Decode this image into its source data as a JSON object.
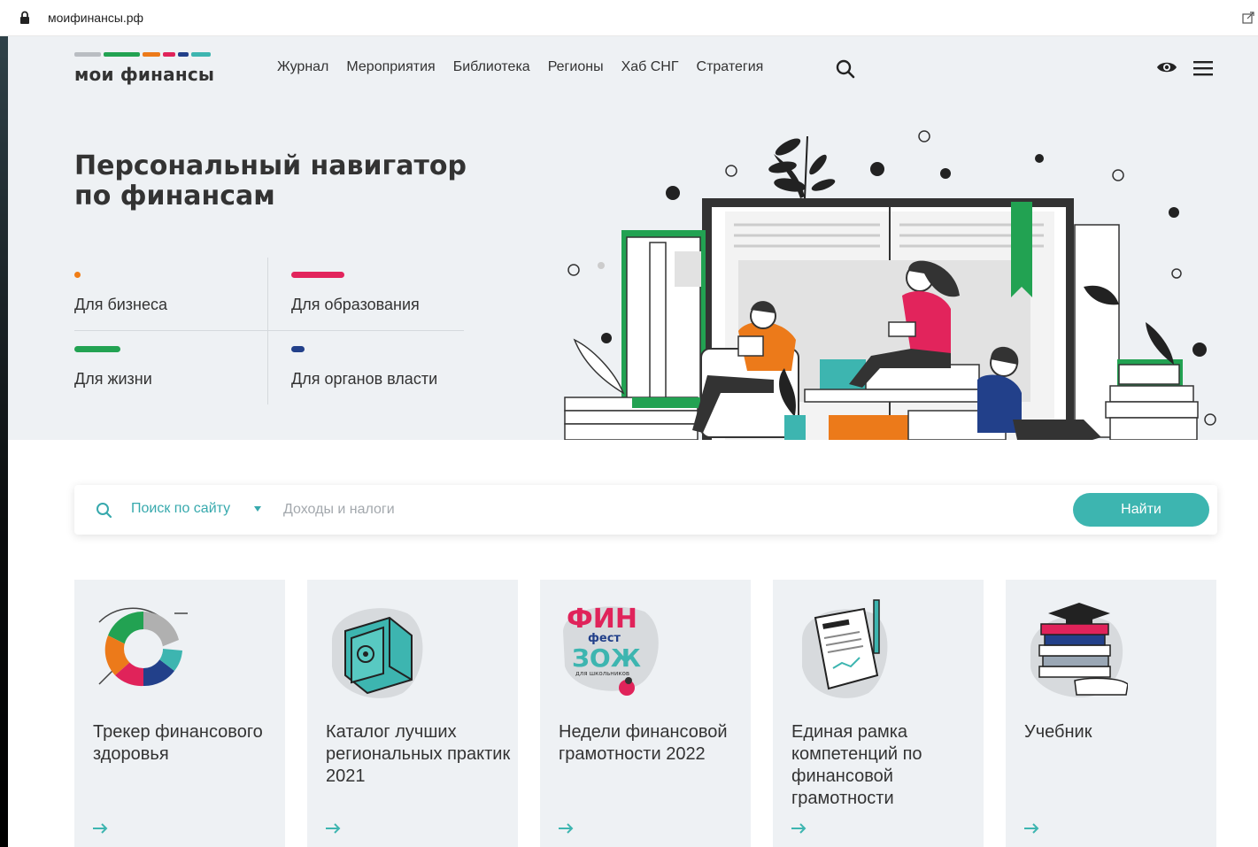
{
  "browser": {
    "url": "моифинансы.рф"
  },
  "header": {
    "logo_text": "мои финансы",
    "logo_colors": [
      "#b9bdc2",
      "#22a252",
      "#ec7a1a",
      "#e0235a",
      "#22408a",
      "#3db5b0"
    ],
    "nav": [
      "Журнал",
      "Мероприятия",
      "Библиотека",
      "Регионы",
      "Хаб СНГ",
      "Стратегия"
    ]
  },
  "hero": {
    "title_line1": "Персональный навигатор",
    "title_line2": "по финансам",
    "audiences": [
      {
        "label": "Для бизнеса",
        "color": "#f07d16"
      },
      {
        "label": "Для образования",
        "color": "#e2245c"
      },
      {
        "label": "Для жизни",
        "color": "#22a252"
      },
      {
        "label": "Для органов власти",
        "color": "#22408a"
      }
    ]
  },
  "search": {
    "scope_label": "Поиск по сайту",
    "placeholder": "Доходы и налоги",
    "button_label": "Найти"
  },
  "cards": [
    {
      "title": "Трекер финансового здоровья",
      "icon": "fin-zozh-logo-icon"
    },
    {
      "title": "Каталог лучших региональных практик 2021",
      "icon": "safe-icon"
    },
    {
      "title": "Недели финансовой грамотности 2022",
      "icon": "finfest-zozh-icon",
      "logo_text_1": "ФИН",
      "logo_text_2": "фест",
      "logo_text_3": "ЗОЖ",
      "logo_text_4": "для школьников"
    },
    {
      "title": "Единая рамка компетенций по финансовой грамотности",
      "icon": "document-icon"
    },
    {
      "title": "Учебник",
      "icon": "books-graduation-cap-icon"
    }
  ],
  "colors": {
    "accent": "#3db5b0",
    "hero_bg": "#eef1f4",
    "card_bg": "#eef1f4"
  }
}
